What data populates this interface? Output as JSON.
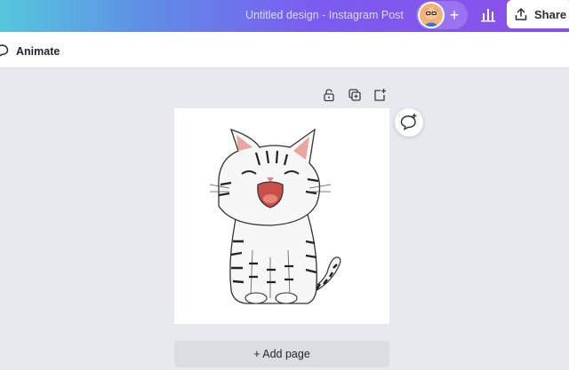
{
  "topbar": {
    "title": "Untitled design - Instagram Post",
    "add_collaborator_symbol": "+",
    "share_label": "Share",
    "icons": {
      "avatar": "user-avatar",
      "stats": "bar-chart-icon",
      "share": "upload-icon"
    }
  },
  "subbar": {
    "animate_label": "Animate",
    "icon": "speech-bubble-icon"
  },
  "toolbar": {
    "icons": [
      "lock-icon",
      "duplicate-icon",
      "add-page-icon"
    ]
  },
  "canvas": {
    "image": "cartoon cat illustration"
  },
  "comment": {
    "icon": "add-comment-icon"
  },
  "footer": {
    "add_page_label": "+ Add page"
  },
  "colors": {
    "gradient_start": "#56c7dc",
    "gradient_end": "#8b4fe9",
    "canvas_bg": "#ffffff",
    "workspace_bg": "#e8e9ee"
  }
}
